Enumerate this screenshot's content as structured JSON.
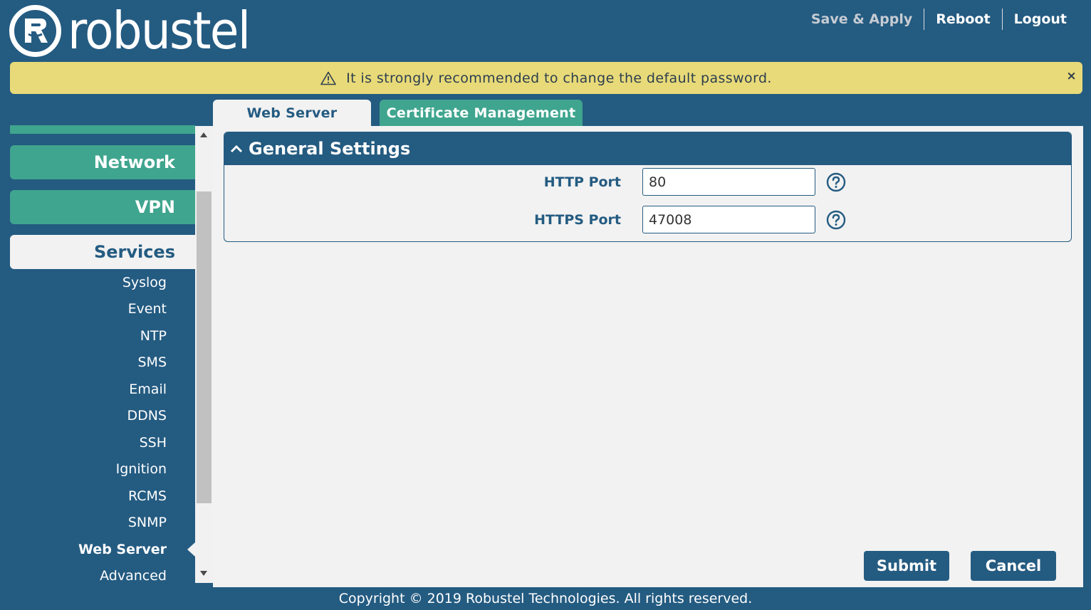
{
  "brand": {
    "name": "robustel"
  },
  "header": {
    "save_apply": "Save & Apply",
    "reboot": "Reboot",
    "logout": "Logout"
  },
  "banner": {
    "message": "It is strongly recommended to change the default password.",
    "close": "×"
  },
  "sidebar": {
    "sections": [
      "Network",
      "VPN",
      "Services"
    ],
    "active_section": "Services",
    "items": [
      "Syslog",
      "Event",
      "NTP",
      "SMS",
      "Email",
      "DDNS",
      "SSH",
      "Ignition",
      "RCMS",
      "SNMP",
      "Web Server",
      "Advanced"
    ],
    "current_item": "Web Server"
  },
  "tabs": [
    {
      "label": "Web Server",
      "active": true
    },
    {
      "label": "Certificate Management",
      "active": false
    }
  ],
  "panel": {
    "title": "General Settings",
    "fields": [
      {
        "label": "HTTP Port",
        "value": "80"
      },
      {
        "label": "HTTPS Port",
        "value": "47008"
      }
    ]
  },
  "actions": {
    "submit": "Submit",
    "cancel": "Cancel"
  },
  "footer": {
    "copyright": "Copyright © 2019 Robustel Technologies. All rights reserved."
  },
  "colors": {
    "primary": "#245b81",
    "accent": "#3fa58e",
    "banner": "#e8da78",
    "content_bg": "#f2f2f2"
  }
}
